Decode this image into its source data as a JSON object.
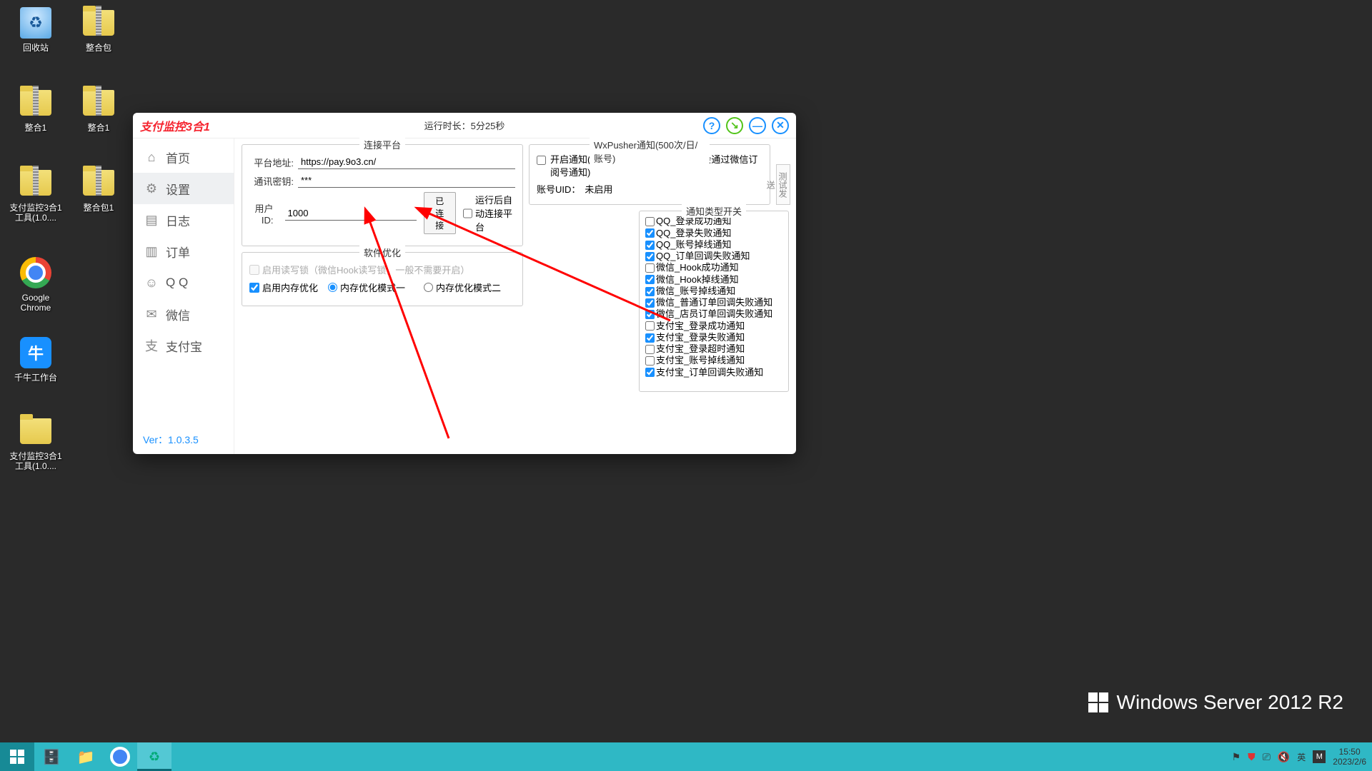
{
  "desktop": {
    "icons": [
      {
        "label": "回收站",
        "type": "recycle"
      },
      {
        "label": "整合包",
        "type": "zip"
      },
      {
        "label": "整合1",
        "type": "zip"
      },
      {
        "label": "整合1",
        "type": "zip"
      },
      {
        "label": "支付监控3合1工具(1.0....",
        "type": "zip"
      },
      {
        "label": "整合包1",
        "type": "zip"
      },
      {
        "label": "Google Chrome",
        "type": "chrome"
      },
      {
        "label": "千牛工作台",
        "type": "blueapp"
      },
      {
        "label": "支付监控3合1工具(1.0....",
        "type": "folder"
      }
    ]
  },
  "watermark": "Windows Server 2012 R2",
  "taskbar": {
    "ime_lang": "英",
    "ime_mode": "M",
    "time": "15:50",
    "date": "2023/2/6"
  },
  "app": {
    "title": "支付监控3合1",
    "runtime": "运行时长：5分25秒",
    "version": "Ver：1.0.3.5",
    "nav": [
      {
        "icon": "⌂",
        "label": "首页"
      },
      {
        "icon": "⚙",
        "label": "设置"
      },
      {
        "icon": "📋",
        "label": "日志"
      },
      {
        "icon": "🧾",
        "label": "订单"
      },
      {
        "icon": "🐧",
        "label": "Q Q"
      },
      {
        "icon": "💬",
        "label": "微信"
      },
      {
        "icon": "支",
        "label": "支付宝"
      }
    ],
    "connect": {
      "title": "连接平台",
      "addr_label": "平台地址:",
      "addr_value": "https://pay.9o3.cn/",
      "key_label": "通讯密钥:",
      "key_value": "***",
      "uid_label": "用户ID:",
      "uid_value": "1000",
      "connect_btn": "已连接",
      "auto_label": "运行后自动连接平台"
    },
    "optimize": {
      "title": "软件优化",
      "lock_label": "启用读写锁（微信Hook读写锁，一般不需要开启）",
      "mem_enable": "启用内存优化",
      "mode1": "内存优化模式一",
      "mode2": "内存优化模式二"
    },
    "wx": {
      "title": "WxPusher通知(500次/日/账号)",
      "enable_label": "开启通知(回调失败或账号掉线等情况会通过微信订阅号通知)",
      "uid_label": "账号UID：",
      "uid_value": "未启用",
      "test_btn": "测试发送"
    },
    "notif": {
      "title": "通知类型开关",
      "items": [
        {
          "checked": false,
          "label": "QQ_登录成功通知"
        },
        {
          "checked": true,
          "label": "QQ_登录失败通知"
        },
        {
          "checked": true,
          "label": "QQ_账号掉线通知"
        },
        {
          "checked": true,
          "label": "QQ_订单回调失败通知"
        },
        {
          "checked": false,
          "label": "微信_Hook成功通知"
        },
        {
          "checked": true,
          "label": "微信_Hook掉线通知"
        },
        {
          "checked": true,
          "label": "微信_账号掉线通知"
        },
        {
          "checked": true,
          "label": "微信_普通订单回调失败通知"
        },
        {
          "checked": true,
          "label": "微信_店员订单回调失败通知"
        },
        {
          "checked": false,
          "label": "支付宝_登录成功通知"
        },
        {
          "checked": true,
          "label": "支付宝_登录失败通知"
        },
        {
          "checked": false,
          "label": "支付宝_登录超时通知"
        },
        {
          "checked": false,
          "label": "支付宝_账号掉线通知"
        },
        {
          "checked": true,
          "label": "支付宝_订单回调失败通知"
        }
      ]
    }
  }
}
